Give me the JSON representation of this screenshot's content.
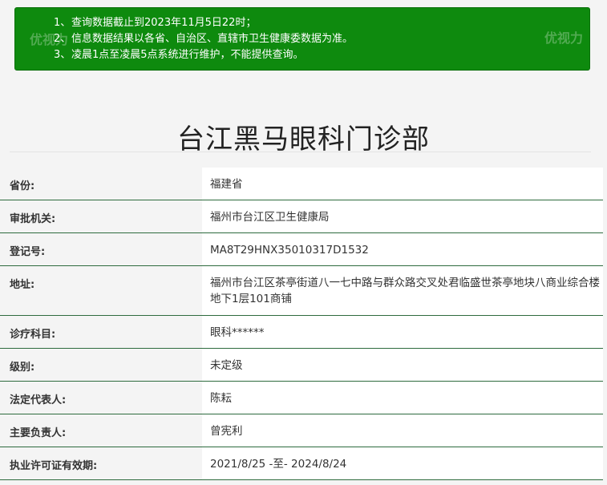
{
  "notice": {
    "lines": [
      {
        "num": "1、",
        "text": "查询数据截止到2023年11月5日22时；"
      },
      {
        "num": "2、",
        "text": "信息数据结果以各省、自治区、直辖市卫生健康委数据为准。"
      },
      {
        "num": "3、",
        "text": "凌晨1点至凌晨5点系统进行维护，不能提供查询。"
      }
    ]
  },
  "page_title": "台江黑马眼科门诊部",
  "watermark": "优视力",
  "rows": [
    {
      "label": "省份:",
      "value": "福建省"
    },
    {
      "label": "审批机关:",
      "value": "福州市台江区卫生健康局"
    },
    {
      "label": "登记号:",
      "value": "MA8T29HNX35010317D1532"
    },
    {
      "label": "地址:",
      "value": "福州市台江区茶亭街道八一七中路与群众路交叉处君临盛世茶亭地块八商业综合楼地下1层101商铺"
    },
    {
      "label": "诊疗科目:",
      "value": "眼科******"
    },
    {
      "label": "级别:",
      "value": "未定级"
    },
    {
      "label": "法定代表人:",
      "value": "陈耘"
    },
    {
      "label": "主要负责人:",
      "value": "曾宪利"
    },
    {
      "label": "执业许可证有效期:",
      "value": "2021/8/25 -至- 2024/8/24"
    }
  ]
}
